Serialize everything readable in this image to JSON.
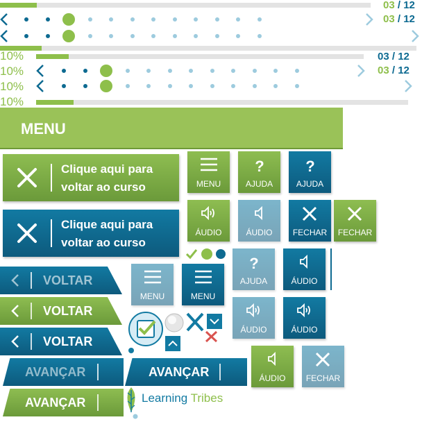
{
  "progress": {
    "current": "03",
    "separator": " / ",
    "total": "12",
    "percent": "10%",
    "fraction": 0.1
  },
  "menu": {
    "title": "MENU"
  },
  "back_to_course": {
    "label_line1": "Clique aqui para",
    "label_line2": "voltar ao curso"
  },
  "buttons": {
    "menu": "MENU",
    "help": "AJUDA",
    "audio": "ÁUDIO",
    "close": "FECHAR",
    "back": "VOLTAR",
    "next": "AVANÇAR"
  },
  "logo": {
    "part1": "Learning",
    "part2": "Tribes"
  },
  "colors": {
    "green": "#8ebf4b",
    "blue": "#0d6a91",
    "light_blue": "#9dcbde",
    "grey": "#e3e3e3"
  },
  "icons": [
    "chevron-left-icon",
    "chevron-right-icon",
    "close-icon",
    "hamburger-icon",
    "help-icon",
    "audio-icon",
    "checkmark-icon",
    "chevron-up-icon",
    "chevron-down-icon",
    "leaf-icon"
  ]
}
